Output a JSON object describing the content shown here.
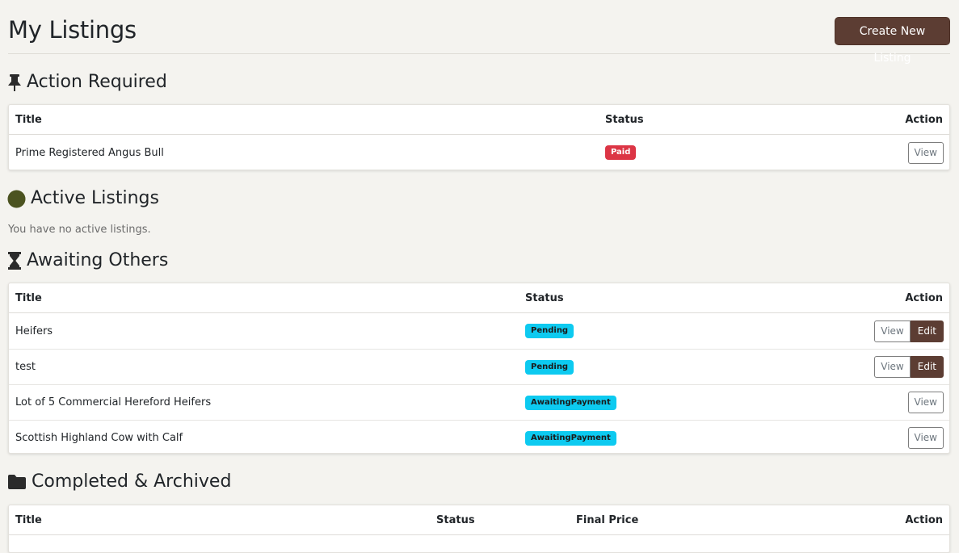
{
  "header": {
    "title": "My Listings",
    "create_button": "Create New Listing"
  },
  "colors": {
    "page_background": "#f4f3ef",
    "brand_brown": "#5c3d33",
    "badge_paid": "#dc3545",
    "badge_info": "#0dcaf0",
    "active_dot": "#4b5320"
  },
  "action_required": {
    "heading": "Action Required",
    "icon": "pushpin-icon",
    "columns": {
      "title": "Title",
      "status": "Status",
      "action": "Action"
    },
    "rows": [
      {
        "title": "Prime Registered Angus Bull",
        "status": "Paid",
        "view": "View"
      }
    ]
  },
  "active": {
    "heading": "Active Listings",
    "icon": "green-circle-icon",
    "empty_text": "You have no active listings."
  },
  "awaiting": {
    "heading": "Awaiting Others",
    "icon": "hourglass-icon",
    "columns": {
      "title": "Title",
      "status": "Status",
      "action": "Action"
    },
    "rows": [
      {
        "title": "Heifers",
        "status": "Pending",
        "view": "View",
        "edit": "Edit"
      },
      {
        "title": "test",
        "status": "Pending",
        "view": "View",
        "edit": "Edit"
      },
      {
        "title": "Lot of 5 Commercial Hereford Heifers",
        "status": "AwaitingPayment",
        "view": "View"
      },
      {
        "title": "Scottish Highland Cow with Calf",
        "status": "AwaitingPayment",
        "view": "View"
      }
    ]
  },
  "completed": {
    "heading": "Completed & Archived",
    "icon": "folder-icon",
    "columns": {
      "title": "Title",
      "status": "Status",
      "final_price": "Final Price",
      "action": "Action"
    }
  }
}
